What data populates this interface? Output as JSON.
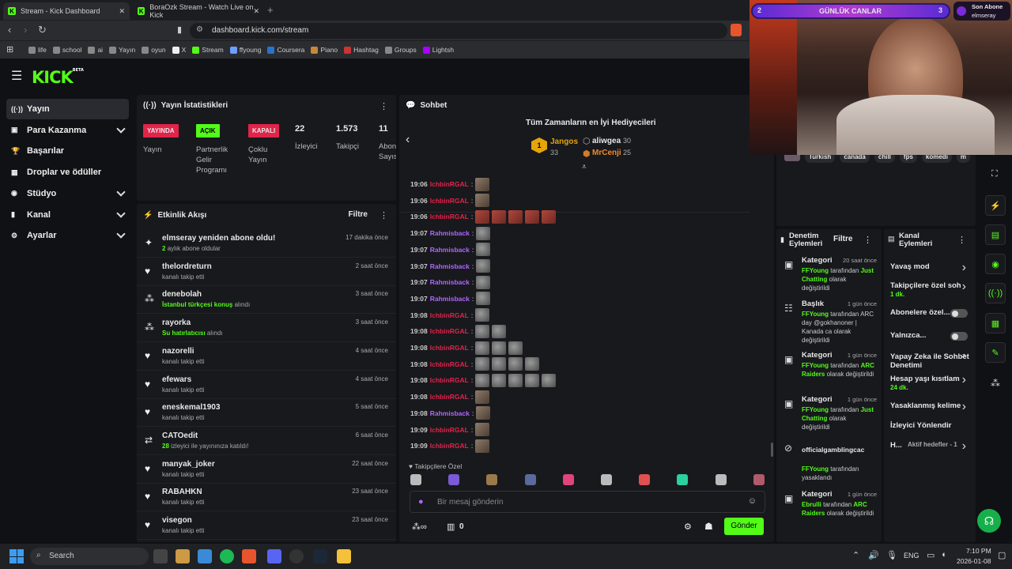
{
  "browser": {
    "tabs": [
      {
        "title": "Stream - Kick Dashboard",
        "active": true
      },
      {
        "title": "BoraOzk Stream - Watch Live on Kick",
        "active": false
      }
    ],
    "url": "dashboard.kick.com/stream",
    "bookmarks": [
      {
        "label": "life",
        "color": "#888"
      },
      {
        "label": "school",
        "color": "#888"
      },
      {
        "label": "ai",
        "color": "#888"
      },
      {
        "label": "Yayın",
        "color": "#888"
      },
      {
        "label": "oyun",
        "color": "#888"
      },
      {
        "label": "X",
        "color": "#eee"
      },
      {
        "label": "Stream",
        "color": "#53fc18"
      },
      {
        "label": "ffyoung",
        "color": "#6aa0ff"
      },
      {
        "label": "Coursera",
        "color": "#2a73cc"
      },
      {
        "label": "Piano",
        "color": "#c7883a"
      },
      {
        "label": "Hashtag",
        "color": "#c33"
      },
      {
        "label": "Groups",
        "color": "#888"
      },
      {
        "label": "Lightsh",
        "color": "#a0f"
      }
    ]
  },
  "logo": {
    "text": "KICK",
    "beta": "BETA"
  },
  "sidebar": [
    {
      "label": "Yayın",
      "active": true
    },
    {
      "label": "Para Kazanma"
    },
    {
      "label": "Başarılar"
    },
    {
      "label": "Droplar ve ödüller"
    },
    {
      "label": "Stüdyo"
    },
    {
      "label": "Kanal"
    },
    {
      "label": "Ayarlar"
    }
  ],
  "stats": {
    "title": "Yayın İstatistikleri",
    "badges": [
      {
        "text": "YAYINDA",
        "label": "Yayın"
      },
      {
        "text": "AÇIK",
        "label": "Partnerlik Gelir Programı"
      },
      {
        "text": "KAPALI",
        "label": "Çoklu Yayın"
      }
    ],
    "numbers": [
      {
        "value": "22",
        "label": "İzleyici"
      },
      {
        "value": "1.573",
        "label": "Takipçi"
      },
      {
        "value": "11",
        "label": "Abon Sayıs"
      }
    ]
  },
  "feed": {
    "title": "Etkinlik Akışı",
    "filter": "Filtre",
    "items": [
      {
        "name": "elmseray yeniden abone oldu!",
        "sub_hl": "2",
        "sub": "aylık abone oldular",
        "time": "17 dakika önce",
        "icon": "✦"
      },
      {
        "name": "thelordreturn",
        "sub_hl": "",
        "sub": "kanalı takip etti",
        "time": "2 saat önce",
        "icon": "♥"
      },
      {
        "name": "denebolah",
        "sub_hl": "İstanbul türkçesi konuş",
        "sub": "alındı",
        "time": "3 saat önce",
        "icon": "⁂"
      },
      {
        "name": "rayorka",
        "sub_hl": "Su hatırlatıcısı",
        "sub": "alındı",
        "time": "3 saat önce",
        "icon": "⁂"
      },
      {
        "name": "nazorelli",
        "sub_hl": "",
        "sub": "kanalı takip etti",
        "time": "4 saat önce",
        "icon": "♥"
      },
      {
        "name": "efewars",
        "sub_hl": "",
        "sub": "kanalı takip etti",
        "time": "4 saat önce",
        "icon": "♥"
      },
      {
        "name": "eneskemal1903",
        "sub_hl": "",
        "sub": "kanalı takip etti",
        "time": "5 saat önce",
        "icon": "♥"
      },
      {
        "name": "CATOedit",
        "sub_hl": "28",
        "sub": "izleyici ile yayınınıza katıldı!",
        "time": "6 saat önce",
        "icon": "⇄"
      },
      {
        "name": "manyak_joker",
        "sub_hl": "",
        "sub": "kanalı takip etti",
        "time": "22 saat önce",
        "icon": "♥"
      },
      {
        "name": "RABAHKN",
        "sub_hl": "",
        "sub": "kanalı takip etti",
        "time": "23 saat önce",
        "icon": "♥"
      },
      {
        "name": "visegon",
        "sub_hl": "",
        "sub": "kanalı takip etti",
        "time": "23 saat önce",
        "icon": "♥"
      }
    ]
  },
  "chat": {
    "title": "Sohbet",
    "gifters_title": "Tüm Zamanların en İyi Hediyecileri",
    "gifters": [
      {
        "rank": "1",
        "name": "Jangos",
        "count": "33"
      },
      {
        "name": "aliwgea",
        "count": "30"
      },
      {
        "name": "MrCenji",
        "count": "25"
      }
    ],
    "messages": [
      {
        "time": "19:06",
        "user": "IchbinRGAL",
        "color": "#e0244a",
        "emotes": [
          "cat"
        ]
      },
      {
        "time": "19:06",
        "user": "IchbinRGAL",
        "color": "#e0244a",
        "emotes": [
          "cat"
        ]
      },
      {
        "time": "19:06",
        "user": "IchbinRGAL",
        "color": "#e0244a",
        "emotes": [
          "red",
          "red",
          "red",
          "red",
          "red"
        ]
      },
      {
        "time": "19:07",
        "user": "Rahmisback",
        "color": "#b066ff",
        "emotes": [
          "gray"
        ]
      },
      {
        "time": "19:07",
        "user": "Rahmisback",
        "color": "#b066ff",
        "emotes": [
          "gray"
        ]
      },
      {
        "time": "19:07",
        "user": "Rahmisback",
        "color": "#b066ff",
        "emotes": [
          "gray"
        ]
      },
      {
        "time": "19:07",
        "user": "Rahmisback",
        "color": "#b066ff",
        "emotes": [
          "gray"
        ]
      },
      {
        "time": "19:07",
        "user": "Rahmisback",
        "color": "#b066ff",
        "emotes": [
          "gray"
        ]
      },
      {
        "time": "19:08",
        "user": "IchbinRGAL",
        "color": "#e0244a",
        "emotes": [
          "gray"
        ]
      },
      {
        "time": "19:08",
        "user": "IchbinRGAL",
        "color": "#e0244a",
        "emotes": [
          "gray",
          "gray"
        ]
      },
      {
        "time": "19:08",
        "user": "IchbinRGAL",
        "color": "#e0244a",
        "emotes": [
          "gray",
          "gray",
          "gray"
        ]
      },
      {
        "time": "19:08",
        "user": "IchbinRGAL",
        "color": "#e0244a",
        "emotes": [
          "gray",
          "gray",
          "gray",
          "gray"
        ]
      },
      {
        "time": "19:08",
        "user": "IchbinRGAL",
        "color": "#e0244a",
        "emotes": [
          "gray",
          "gray",
          "gray",
          "gray",
          "gray"
        ]
      },
      {
        "time": "19:08",
        "user": "IchbinRGAL",
        "color": "#e0244a",
        "emotes": [
          "cat"
        ]
      },
      {
        "time": "19:08",
        "user": "Rahmisback",
        "color": "#b066ff",
        "emotes": [
          "cat"
        ]
      },
      {
        "time": "19:09",
        "user": "IchbinRGAL",
        "color": "#e0244a",
        "emotes": [
          "cat"
        ]
      },
      {
        "time": "19:09",
        "user": "IchbinRGAL",
        "color": "#e0244a",
        "emotes": [
          "cat"
        ]
      }
    ],
    "followers_only": "Takipçilere Özel",
    "placeholder": "Bir mesaj gönderin",
    "points": "0",
    "send": "Gönder"
  },
  "tags": [
    "Turkish",
    "canada",
    "chill",
    "fps",
    "komedi",
    "m"
  ],
  "mod": {
    "title": "Denetim Eylemleri",
    "filter": "Filtre",
    "items": [
      {
        "type": "Kategori",
        "time": "20 saat önce",
        "actor": "FFYoung",
        "mid": "tarafından",
        "hl": "Just Chatting",
        "rest": "olarak değiştirildi"
      },
      {
        "type": "Başlık",
        "time": "1 gün önce",
        "actor": "FFYoung",
        "mid": "tarafından",
        "hl": "",
        "rest": "ARC day @gokhanoner | Kanada ca olarak değiştirildi"
      },
      {
        "type": "Kategori",
        "time": "1 gün önce",
        "actor": "FFYoung",
        "mid": "tarafından",
        "hl": "ARC Raiders",
        "rest": "olarak değiştirildi"
      },
      {
        "type": "Kategori",
        "time": "1 gün önce",
        "actor": "FFYoung",
        "mid": "tarafından",
        "hl": "Just Chatting",
        "rest": "olarak değiştirildi"
      },
      {
        "type": "officialgamblingcac",
        "time": "",
        "actor": "FFYoung",
        "mid": "tarafından",
        "hl": "",
        "rest": "yasaklandı"
      },
      {
        "type": "Kategori",
        "time": "1 gün önce",
        "actor": "Ebrulli",
        "mid": "tarafından",
        "hl": "ARC Raiders",
        "rest": "olarak değiştirildi"
      }
    ]
  },
  "kanal": {
    "title": "Kanal Eylemleri",
    "items": [
      {
        "label": "Yavaş mod",
        "sub": "",
        "ctrl": "chev"
      },
      {
        "label": "Takipçilere özel soh",
        "sub": "1 dk.",
        "ctrl": "chev"
      },
      {
        "label": "Abonelere özel...",
        "sub": "",
        "ctrl": "toggle"
      },
      {
        "label": "Yalnızca...",
        "sub": "",
        "ctrl": "toggle"
      },
      {
        "label": "Yapay Zeka ile Sohbet Denetimi",
        "sub": "",
        "ctrl": "ext"
      },
      {
        "label": "Hesap yaşı kısıtlam",
        "sub": "24 dk.",
        "ctrl": "chev"
      },
      {
        "label": "Yasaklanmış kelime",
        "sub": "",
        "ctrl": "chev"
      },
      {
        "label": "İzleyici Yönlendir",
        "sub": "",
        "ctrl": "none"
      },
      {
        "label": "H...",
        "sub": "Aktif hedefler - 1",
        "ctrl": "chev"
      }
    ]
  },
  "overlay": {
    "goal_left": "2",
    "goal_title": "GÜNLÜK CANLAR",
    "goal_right": "3",
    "sub_title": "Son Abone",
    "sub_name": "elmseray"
  },
  "taskbar": {
    "search": "Search",
    "lang": "ENG",
    "time": "7:10 PM",
    "date": "2026-01-08"
  }
}
